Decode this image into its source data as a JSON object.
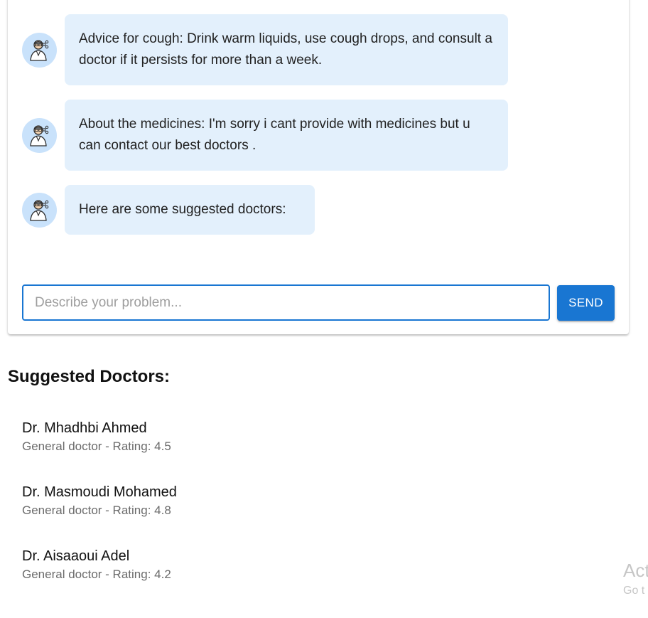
{
  "chat": {
    "messages": [
      {
        "avatar_icon": "doctor-avatar-icon",
        "text": "Advice for cough: Drink warm liquids, use cough drops, and consult a doctor if it persists for more than a week."
      },
      {
        "avatar_icon": "doctor-avatar-icon",
        "text": "About the medicines: I'm sorry i cant provide with medicines but u can contact our best doctors ."
      },
      {
        "avatar_icon": "doctor-avatar-icon",
        "text": "Here are some suggested doctors:"
      }
    ],
    "input": {
      "placeholder": "Describe your problem...",
      "value": ""
    },
    "send_label": "SEND"
  },
  "suggested": {
    "title": "Suggested Doctors:",
    "doctors": [
      {
        "name": "Dr. Mhadhbi Ahmed",
        "meta": "General doctor - Rating: 4.5"
      },
      {
        "name": "Dr. Masmoudi Mohamed",
        "meta": "General doctor - Rating: 4.8"
      },
      {
        "name": "Dr. Aisaaoui Adel",
        "meta": "General doctor - Rating: 4.2"
      }
    ]
  },
  "watermark": {
    "title": "Act",
    "subtitle": "Go t"
  },
  "colors": {
    "accent": "#1976d2",
    "bubble": "#e3f0fc",
    "avatar_bg": "#c9e2fb"
  }
}
